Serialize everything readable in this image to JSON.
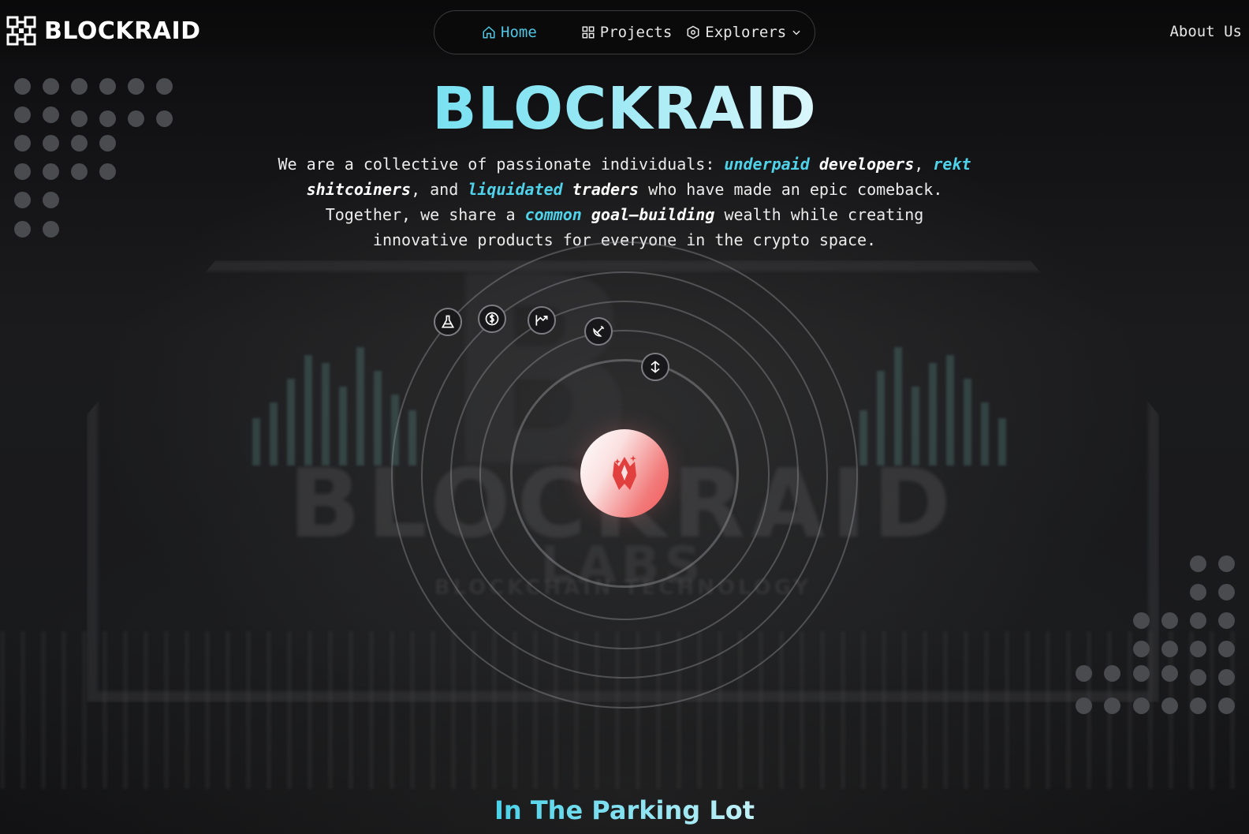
{
  "brand": {
    "name": "BLOCKRAID",
    "icon": "blocks-logo-icon"
  },
  "nav": {
    "items": [
      {
        "label": "Home",
        "icon": "home-icon",
        "active": true
      },
      {
        "label": "Projects",
        "icon": "grid-icon",
        "active": false
      },
      {
        "label": "Explorers",
        "icon": "cube-hex-icon",
        "active": false,
        "dropdown": true
      }
    ],
    "about": "About Us"
  },
  "hero": {
    "title": "BLOCKRAID",
    "desc": {
      "p1": "We are a collective of passionate individuals: ",
      "h1": "underpaid",
      "w1": "developers",
      "p2": ",",
      "h2": "rekt",
      "w2": "shitcoiners",
      "p3": ", and ",
      "h3": "liquidated",
      "w3": "traders",
      "p4": " who have made an epic comeback. Together, we share a ",
      "h4": "common",
      "w4": "goal—building",
      "p5": " wealth while creating innovative products for everyone in the crypto space."
    }
  },
  "orbit": {
    "icons": [
      "flask-icon",
      "dollar-coin-icon",
      "chart-arrow-icon",
      "satellite-icon",
      "swap-arrows-icon"
    ],
    "core_icon": "crystal-fire-logo-icon"
  },
  "section": {
    "title": "In The Parking Lot"
  },
  "colors": {
    "accent": "#4fc6e3",
    "core_red": "#f45a5a",
    "background": "#111214"
  }
}
